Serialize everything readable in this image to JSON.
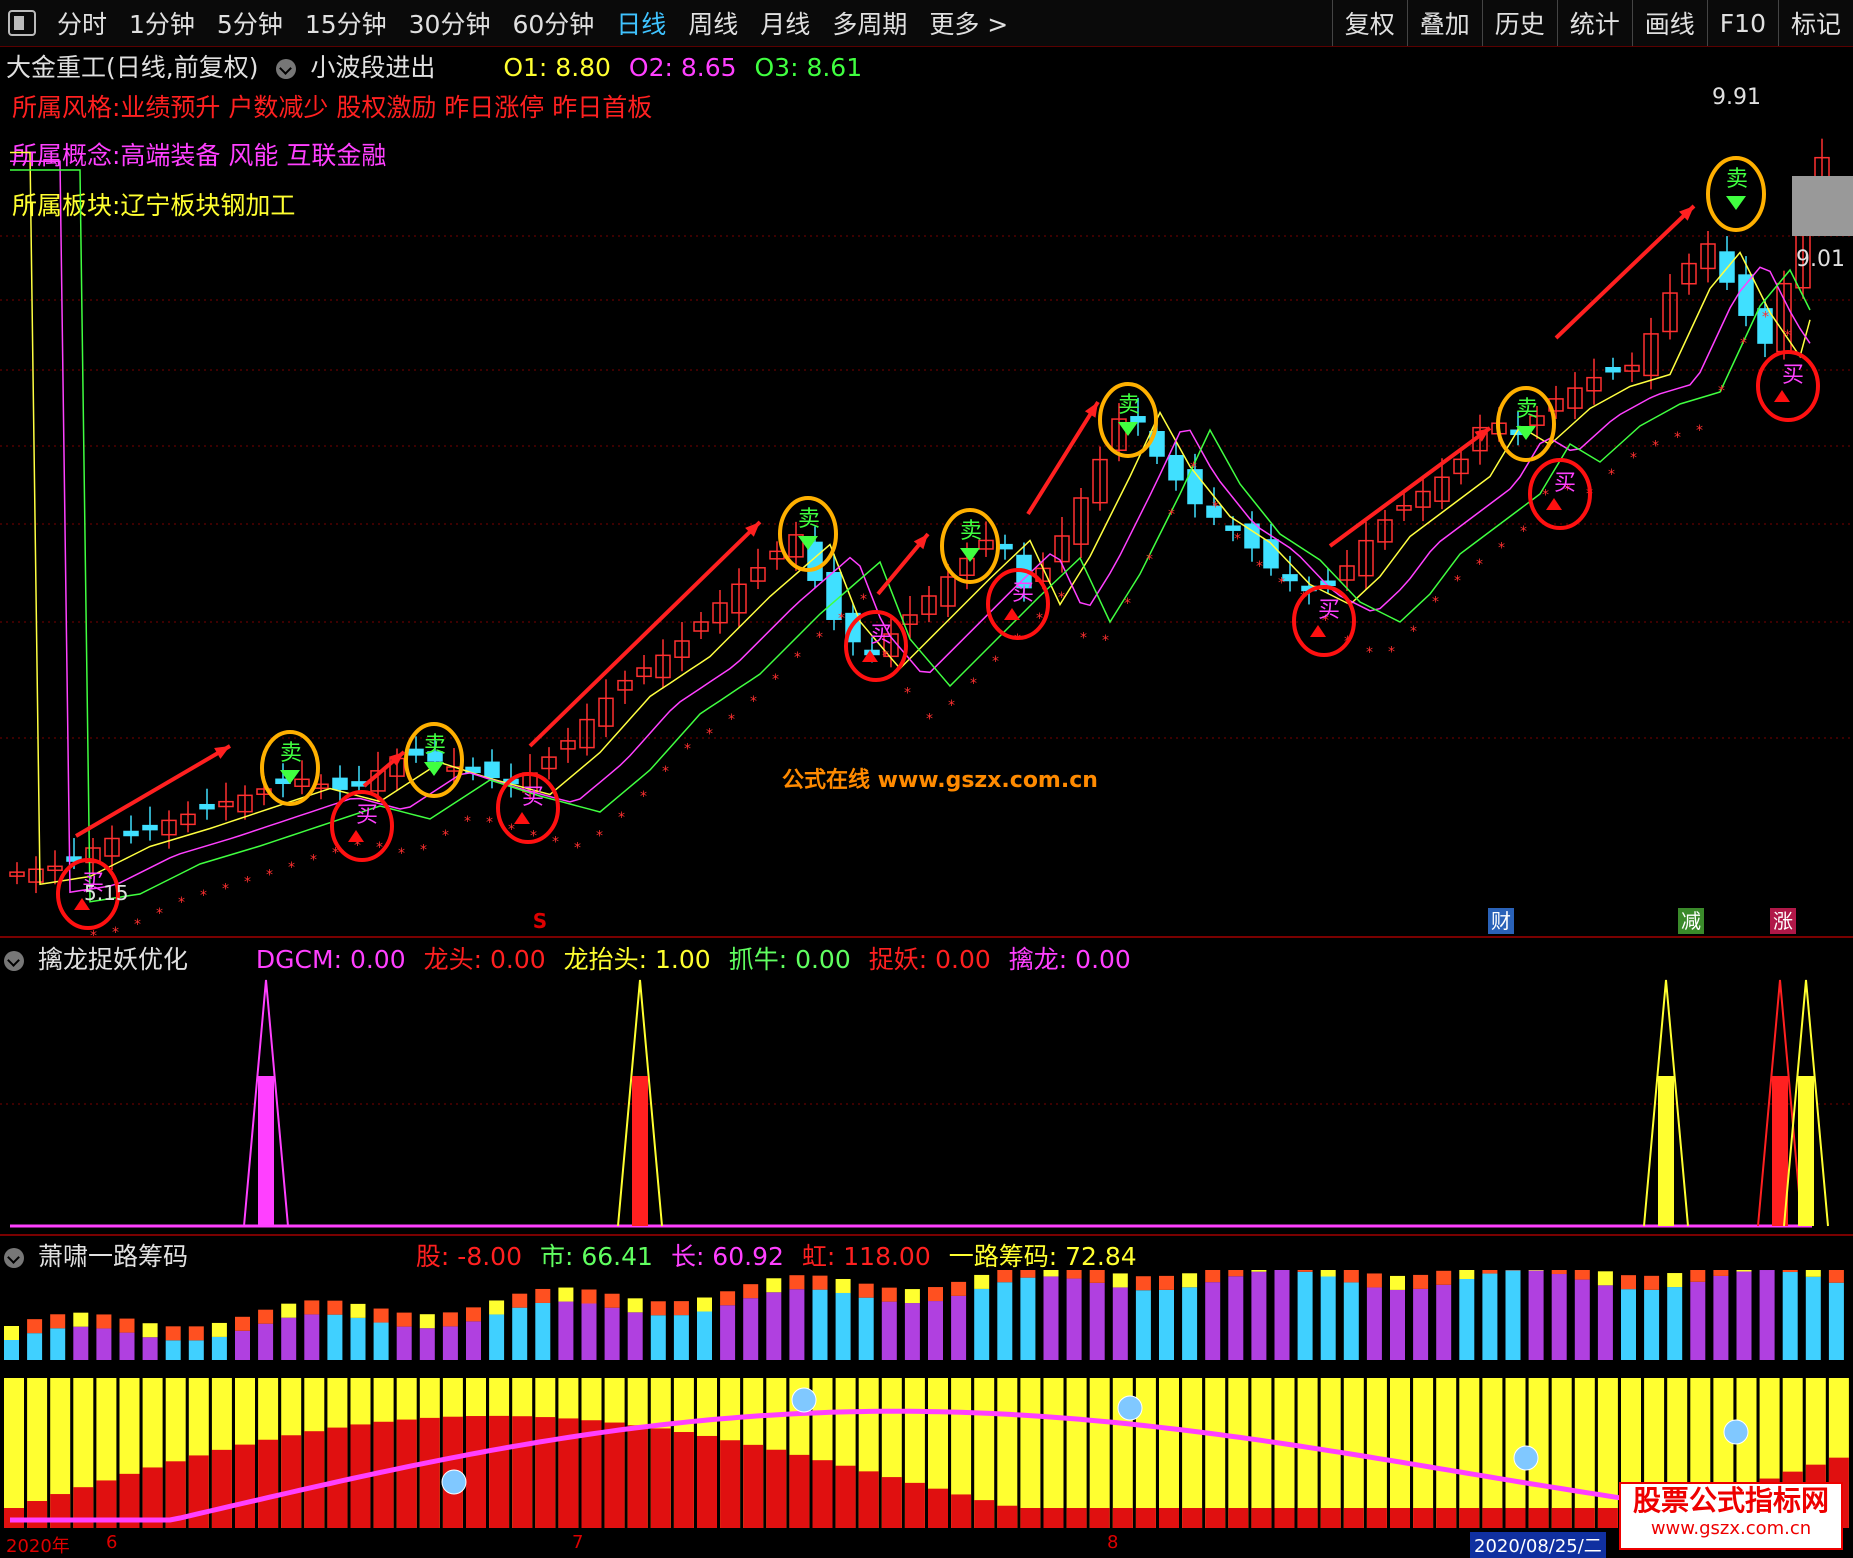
{
  "toolbar": {
    "timeframes": [
      "分时",
      "1分钟",
      "5分钟",
      "15分钟",
      "30分钟",
      "60分钟",
      "日线",
      "周线",
      "月线",
      "多周期",
      "更多 >"
    ],
    "active_index": 6,
    "right_buttons": [
      "复权",
      "叠加",
      "历史",
      "统计",
      "画线",
      "F10",
      "标记"
    ]
  },
  "main_panel": {
    "title": "大金重工(日线,前复权)",
    "indicator": "小波段进出",
    "o1": "O1: 8.80",
    "o2": "O2: 8.65",
    "o3": "O3: 8.61",
    "style_line": "所属风格:业绩预升 户数减少 股权激励 昨日涨停 昨日首板",
    "concept_line": "所属概念:高端装备 风能 互联金融",
    "sector_line": "所属板块:辽宁板块钢加工",
    "high_label": "9.91",
    "last_label": "9.01",
    "low_label": "5.15",
    "buy_char": "买",
    "sell_char": "卖",
    "watermark": "公式在线  www.gszx.com.cn",
    "event_s": "S",
    "events": [
      {
        "text": "财",
        "color": "#2a62b8"
      },
      {
        "text": "减",
        "color": "#3a8a2a"
      },
      {
        "text": "涨",
        "color": "#b01848"
      }
    ]
  },
  "panel2": {
    "title": "擒龙捉妖优化",
    "values": [
      {
        "label": "DGCM: 0.00",
        "color": "#ff40ff"
      },
      {
        "label": "龙头: 0.00",
        "color": "#ff2020"
      },
      {
        "label": "龙抬头: 1.00",
        "color": "#ffff30"
      },
      {
        "label": "抓牛: 0.00",
        "color": "#60ff60"
      },
      {
        "label": "捉妖: 0.00",
        "color": "#ff2020"
      },
      {
        "label": "擒龙: 0.00",
        "color": "#ff40ff"
      }
    ]
  },
  "panel3": {
    "title": "萧啸一路筹码",
    "values": [
      {
        "label": "股: -8.00",
        "color": "#ff2020"
      },
      {
        "label": "市: 66.41",
        "color": "#60ff60"
      },
      {
        "label": "长: 60.92",
        "color": "#ff40ff"
      },
      {
        "label": "虹: 118.00",
        "color": "#ff2020"
      },
      {
        "label": "一路筹码: 72.84",
        "color": "#ffff30"
      }
    ]
  },
  "date_axis": {
    "year": "2020年",
    "m6": "6",
    "m7": "7",
    "m8": "8",
    "cursor_date": "2020/08/25/二"
  },
  "brand": {
    "line1": "股票公式指标网",
    "line2": "www.gszx.com.cn"
  },
  "colors": {
    "up": "#ff3030",
    "down": "#40e0ff",
    "ma1": "#ffff40",
    "ma2": "#ff40ff",
    "ma3": "#40ff40",
    "grid": "#7a0000"
  },
  "icons": [
    "window-icon",
    "collapse-icon",
    "buy-circle-icon",
    "sell-circle-icon",
    "trend-arrow-icon"
  ]
}
